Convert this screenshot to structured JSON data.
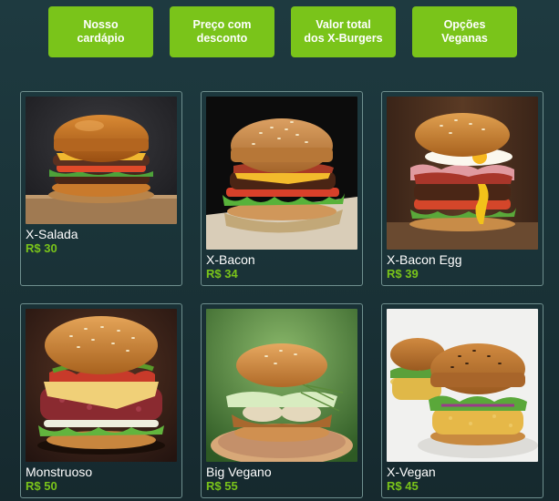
{
  "nav": {
    "items": [
      {
        "label": "Nosso\ncardápio"
      },
      {
        "label": "Preço com\ndesconto"
      },
      {
        "label": "Valor total\ndos X-Burgers"
      },
      {
        "label": "Opções\nVeganas"
      }
    ]
  },
  "menu": {
    "items": [
      {
        "name": "X-Salada",
        "price": "R$ 30"
      },
      {
        "name": "X-Bacon",
        "price": "R$ 34"
      },
      {
        "name": "X-Bacon Egg",
        "price": "R$ 39"
      },
      {
        "name": "Monstruoso",
        "price": "R$ 50"
      },
      {
        "name": "Big Vegano",
        "price": "R$ 55"
      },
      {
        "name": "X-Vegan",
        "price": "R$ 45"
      }
    ]
  },
  "colors": {
    "accent": "#7ac41a",
    "background": "#1e3a40",
    "card_border": "#6f8f8e"
  }
}
